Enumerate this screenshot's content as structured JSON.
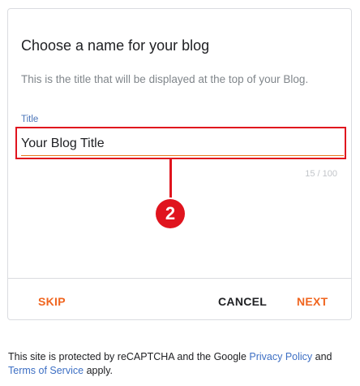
{
  "dialog": {
    "title": "Choose a name for your blog",
    "description": "This is the title that will be displayed at the top of your Blog.",
    "field_label": "Title",
    "field_value": "Your Blog Title",
    "char_counter": "15 / 100",
    "skip_label": "SKIP",
    "cancel_label": "CANCEL",
    "next_label": "NEXT"
  },
  "callout": {
    "number": "2",
    "color": "#e0141e"
  },
  "footer": {
    "text_prefix": "This site is protected by reCAPTCHA and the Google ",
    "privacy_link": "Privacy Policy",
    "text_and": " and ",
    "terms_link": "Terms of Service",
    "text_suffix": " apply."
  },
  "colors": {
    "accent": "#f0651f",
    "link": "#3d6fc4",
    "label": "#4a74b8"
  }
}
